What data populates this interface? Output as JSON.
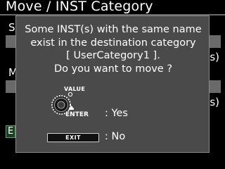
{
  "background": {
    "title": "Move / INST Category",
    "section1_label": "So",
    "section1_suffix": "s)",
    "section2_label": "M",
    "section2_suffix": "s)",
    "exit_fragment": "E"
  },
  "dialog": {
    "lines": [
      "Some INST(s) with the same name",
      "exist in the destination category",
      "[ UserCategory1 ].",
      "Do you want to move ?"
    ],
    "value_label": "VALUE",
    "enter_label": "ENTER",
    "yes_label": ": Yes",
    "exit_key_label": "EXIT",
    "no_label": ": No"
  },
  "icons": [
    "value-knob-icon",
    "enter-arrow-icon"
  ]
}
